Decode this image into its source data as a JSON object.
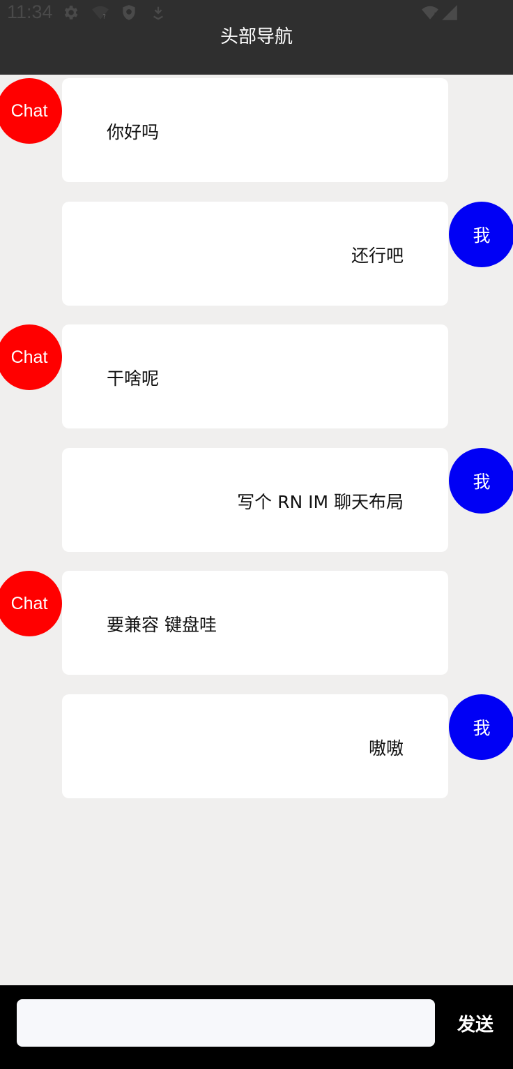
{
  "status_bar": {
    "time": "11:34"
  },
  "header": {
    "title": "头部导航"
  },
  "messages": [
    {
      "sender": "other",
      "avatar_label": "Chat",
      "text": "你好吗"
    },
    {
      "sender": "me",
      "avatar_label": "我",
      "text": "还行吧"
    },
    {
      "sender": "other",
      "avatar_label": "Chat",
      "text": "干啥呢"
    },
    {
      "sender": "me",
      "avatar_label": "我",
      "text": "写个 RN IM 聊天布局"
    },
    {
      "sender": "other",
      "avatar_label": "Chat",
      "text": "要兼容 键盘哇"
    },
    {
      "sender": "me",
      "avatar_label": "我",
      "text": "嗷嗷"
    }
  ],
  "composer": {
    "input_value": "",
    "placeholder": "",
    "send_label": "发送"
  },
  "colors": {
    "other_avatar": "#ff0000",
    "me_avatar": "#0000f5",
    "header_bg": "#2f2f2f",
    "chat_bg": "#f0efee",
    "bottom_bar_bg": "#000000"
  },
  "icons": [
    "gear-icon",
    "wifi-question-icon",
    "shield-icon",
    "download-icon",
    "wifi-alert-icon",
    "signal-icon"
  ]
}
